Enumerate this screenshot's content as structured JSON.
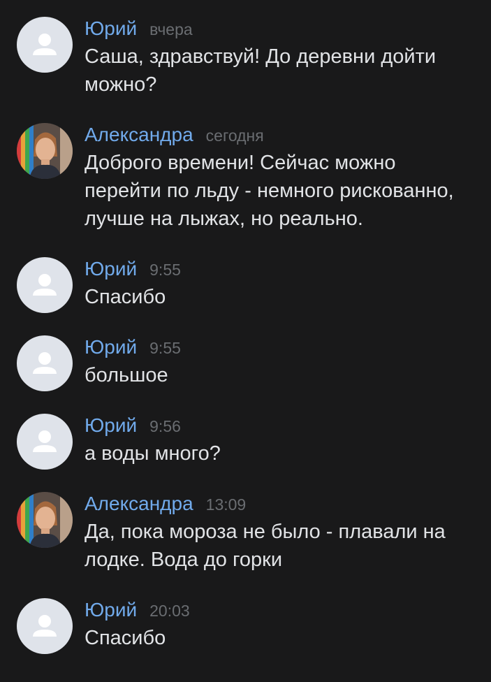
{
  "messages": [
    {
      "author": "Юрий",
      "time": "вчера",
      "text": "Саша, здравствуй! До деревни дойти\nможно?",
      "avatar": "default-user-icon"
    },
    {
      "author": "Александра",
      "time": "сегодня",
      "text": "Доброго времени! Сейчас можно\nперейти по льду - немного рискованно,\nлучше на лыжах, но реально.",
      "avatar": "user-photo"
    },
    {
      "author": "Юрий",
      "time": "9:55",
      "text": "Спасибо",
      "avatar": "default-user-icon"
    },
    {
      "author": "Юрий",
      "time": "9:55",
      "text": "большое",
      "avatar": "default-user-icon"
    },
    {
      "author": "Юрий",
      "time": "9:56",
      "text": "а воды много?",
      "avatar": "default-user-icon"
    },
    {
      "author": "Александра",
      "time": "13:09",
      "text": "Да, пока мороза не было - плавали на\nлодке. Вода до горки",
      "avatar": "user-photo"
    },
    {
      "author": "Юрий",
      "time": "20:03",
      "text": "Спасибо",
      "avatar": "default-user-icon"
    }
  ],
  "colors": {
    "background": "#19191a",
    "author_name": "#71aaeb",
    "timestamp": "#6a6d71",
    "message_text": "#e1e3e6",
    "default_avatar_bg": "#dfe3ea",
    "default_avatar_fg": "#ffffff"
  }
}
